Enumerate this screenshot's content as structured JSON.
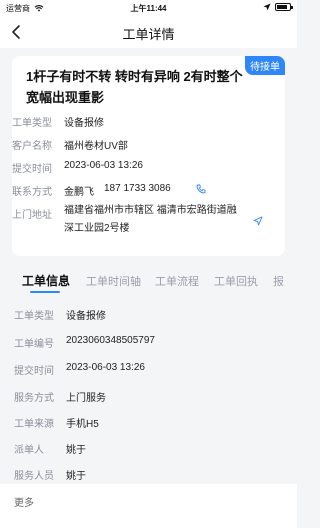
{
  "status_bar": {
    "carrier": "运营商",
    "time": "上午11:44",
    "battery_level": 0.8
  },
  "header": {
    "title": "工单详情"
  },
  "card": {
    "badge": "待接单",
    "title": "1杆子有时不转 转时有异响 2有时整个宽幅出现重影",
    "rows": [
      {
        "label": "工单类型",
        "value": "设备报修"
      },
      {
        "label": "客户名称",
        "value": "福州卷材UV部"
      },
      {
        "label": "提交时间",
        "value": "2023-06-03 13:26"
      },
      {
        "label": "联系方式",
        "value": "金鹏飞",
        "phone": "187 1733 3086"
      },
      {
        "label": "上门地址",
        "value": "福建省福州市市辖区 福清市宏路街道融深工业园2号楼"
      }
    ]
  },
  "tabs": [
    "工单信息",
    "工单时间轴",
    "工单流程",
    "工单回执",
    "报"
  ],
  "details": [
    {
      "label": "工单类型",
      "value": "设备报修"
    },
    {
      "label": "工单编号",
      "value": "2023060348505797"
    },
    {
      "label": "提交时间",
      "value": "2023-06-03 13:26"
    },
    {
      "label": "服务方式",
      "value": "上门服务"
    },
    {
      "label": "工单来源",
      "value": "手机H5"
    },
    {
      "label": "派单人",
      "value": "姚于"
    },
    {
      "label": "服务人员",
      "value": "姚于"
    }
  ],
  "footer": {
    "more_label": "更多"
  },
  "colors": {
    "accent": "#2f86f6",
    "label_gray": "#8a8f99"
  },
  "icons": [
    "wifi-icon",
    "location-arrow-icon",
    "battery-icon",
    "back-icon",
    "phone-icon",
    "navigate-icon"
  ]
}
